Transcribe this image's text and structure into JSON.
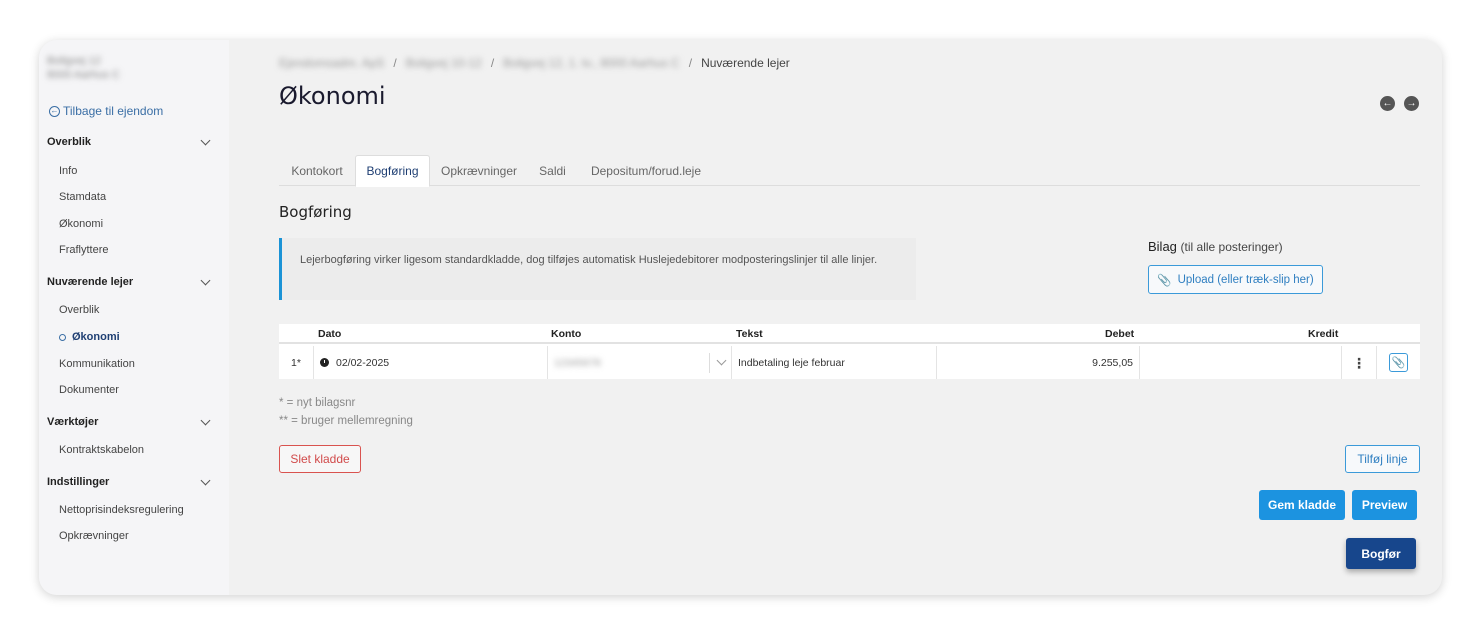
{
  "sidebar": {
    "address_line1": "Boligvej 12",
    "address_line2": "8000 Aarhus C",
    "back_label": "Tilbage til ejendom",
    "sections": [
      {
        "title": "Overblik",
        "items": [
          "Info",
          "Stamdata",
          "Økonomi",
          "Fraflyttere"
        ]
      },
      {
        "title": "Nuværende lejer",
        "items": [
          "Overblik",
          "Økonomi",
          "Kommunikation",
          "Dokumenter"
        ]
      },
      {
        "title": "Værktøjer",
        "items": [
          "Kontraktskabelon"
        ]
      },
      {
        "title": "Indstillinger",
        "items": [
          "Nettoprisindeksregulering",
          "Opkrævninger"
        ]
      }
    ]
  },
  "breadcrumbs": [
    "Ejendomsadm. ApS",
    "Boligvej 10-12",
    "Boligvej 12, 1. tv., 8000 Aarhus C",
    "Nuværende lejer"
  ],
  "page_title": "Økonomi",
  "tabs": [
    "Kontokort",
    "Bogføring",
    "Opkrævninger",
    "Saldi",
    "Depositum/forud.leje"
  ],
  "section_title": "Bogføring",
  "info_text": "Lejerbogføring virker ligesom standardkladde, dog tilføjes automatisk Huslejedebitorer modposteringslinjer til alle linjer.",
  "bilag": {
    "title": "Bilag",
    "subtitle": "(til alle posteringer)",
    "upload_label": "Upload (eller træk-slip her)"
  },
  "table": {
    "headers": [
      "Dato",
      "Konto",
      "Tekst",
      "Debet",
      "Kredit"
    ],
    "rows": [
      {
        "nr": "1*",
        "dato": "02/02-2025",
        "konto": "12345678",
        "tekst": "Indbetaling leje februar",
        "debet": "9.255,05",
        "kredit": ""
      }
    ]
  },
  "legend": {
    "line1": "* = nyt bilagsnr",
    "line2": "** = bruger mellemregning"
  },
  "buttons": {
    "slet": "Slet kladde",
    "tilfoj": "Tilføj linje",
    "gem": "Gem kladde",
    "preview": "Preview",
    "bogfor": "Bogfør"
  },
  "colors": {
    "accent": "#1c93e0",
    "primary_dark": "#17468c",
    "danger": "#d9534f"
  }
}
